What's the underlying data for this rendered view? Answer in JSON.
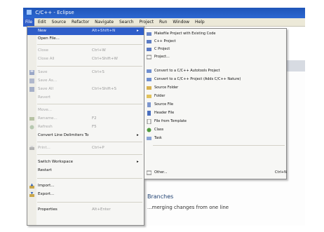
{
  "window": {
    "title": "C/C++ - Eclipse"
  },
  "menubar": {
    "items": [
      "File",
      "Edit",
      "Source",
      "Refactor",
      "Navigate",
      "Search",
      "Project",
      "Run",
      "Window",
      "Help"
    ]
  },
  "file_menu": {
    "items": [
      {
        "label": "New",
        "shortcut": "Alt+Shift+N",
        "arrow": "▸",
        "state": "selected"
      },
      {
        "label": "Open File...",
        "shortcut": "",
        "state": "normal"
      },
      {
        "label": "Close",
        "shortcut": "Ctrl+W",
        "state": "disabled"
      },
      {
        "label": "Close All",
        "shortcut": "Ctrl+Shift+W",
        "state": "disabled"
      },
      {
        "label": "Save",
        "shortcut": "Ctrl+S",
        "state": "disabled"
      },
      {
        "label": "Save As...",
        "shortcut": "",
        "state": "disabled"
      },
      {
        "label": "Save All",
        "shortcut": "Ctrl+Shift+S",
        "state": "disabled"
      },
      {
        "label": "Revert",
        "shortcut": "",
        "state": "disabled"
      },
      {
        "label": "Move...",
        "shortcut": "",
        "state": "disabled"
      },
      {
        "label": "Rename...",
        "shortcut": "F2",
        "state": "disabled"
      },
      {
        "label": "Refresh",
        "shortcut": "F5",
        "state": "disabled"
      },
      {
        "label": "Convert Line Delimiters To",
        "shortcut": "",
        "arrow": "▸",
        "state": "normal"
      },
      {
        "label": "Print...",
        "shortcut": "Ctrl+P",
        "state": "disabled"
      },
      {
        "label": "Switch Workspace",
        "shortcut": "",
        "arrow": "▸",
        "state": "normal"
      },
      {
        "label": "Restart",
        "shortcut": "",
        "state": "normal"
      },
      {
        "label": "Import...",
        "shortcut": "",
        "state": "normal"
      },
      {
        "label": "Export...",
        "shortcut": "",
        "state": "normal"
      },
      {
        "label": "Properties",
        "shortcut": "Alt+Enter",
        "state": "normal"
      }
    ]
  },
  "new_menu": {
    "items": [
      {
        "label": "Makefile Project with Existing Code",
        "shortcut": ""
      },
      {
        "label": "C++ Project",
        "shortcut": ""
      },
      {
        "label": "C Project",
        "shortcut": ""
      },
      {
        "label": "Project...",
        "shortcut": ""
      },
      {
        "label": "Convert to a C/C++ Autotools Project",
        "shortcut": ""
      },
      {
        "label": "Convert to a C/C++ Project (Adds C/C++ Nature)",
        "shortcut": ""
      },
      {
        "label": "Source Folder",
        "shortcut": ""
      },
      {
        "label": "Folder",
        "shortcut": ""
      },
      {
        "label": "Source File",
        "shortcut": ""
      },
      {
        "label": "Header File",
        "shortcut": ""
      },
      {
        "label": "File from Template",
        "shortcut": ""
      },
      {
        "label": "Class",
        "shortcut": ""
      },
      {
        "label": "Task",
        "shortcut": ""
      },
      {
        "label": "Other...",
        "shortcut": "Ctrl+N"
      }
    ]
  },
  "background": {
    "heading": "Branches",
    "text": "...merging changes from one line"
  },
  "colors": {
    "selection": "#2f5ec9",
    "titlebar": "#1f55b8",
    "menubar": "#ece9d8"
  }
}
